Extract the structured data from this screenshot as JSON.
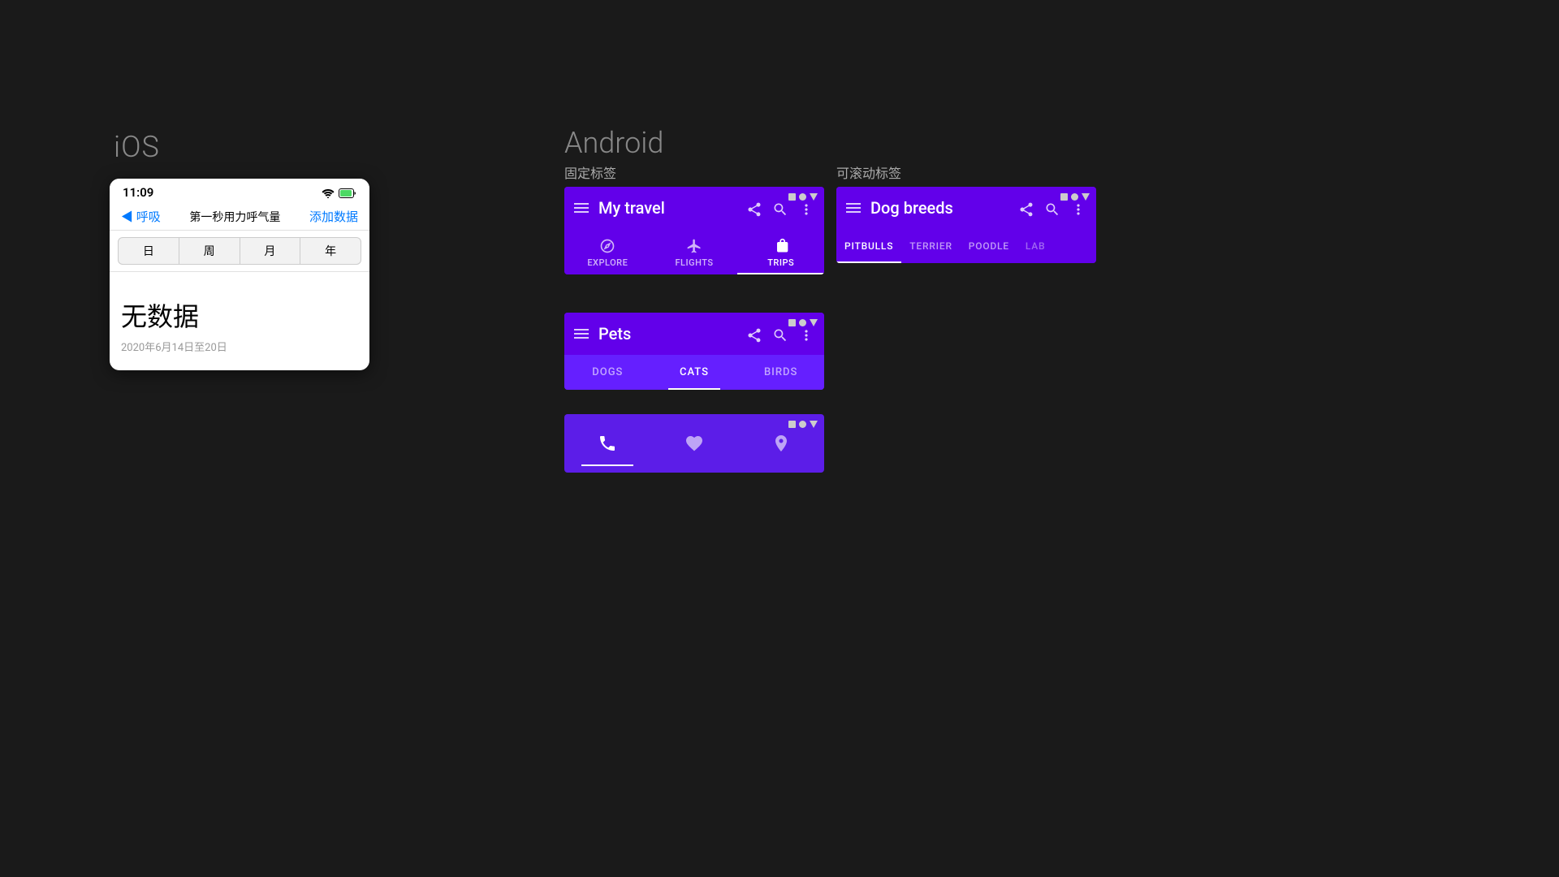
{
  "ios": {
    "section_label": "iOS",
    "status_bar": {
      "time": "11:09",
      "icons": "▶ 📶 🔋"
    },
    "nav": {
      "back_label": "◀ 呼吸",
      "title": "第一秒用力呼气量",
      "action": "添加数据"
    },
    "tabs": [
      "日",
      "周",
      "月",
      "年"
    ],
    "no_data": "无数据",
    "date_range": "2020年6月14日至20日"
  },
  "android": {
    "section_label": "Android",
    "fixed_label": "固定标签",
    "scrollable_label": "可滚动标签",
    "travel_card": {
      "title": "My travel",
      "tabs": [
        {
          "icon": "compass",
          "label": "EXPLORE",
          "active": false
        },
        {
          "icon": "flight",
          "label": "FLIGHTS",
          "active": false
        },
        {
          "icon": "briefcase",
          "label": "TRIPS",
          "active": true
        }
      ]
    },
    "pets_card": {
      "title": "Pets",
      "tabs": [
        {
          "label": "DOGS",
          "active": false
        },
        {
          "label": "CATS",
          "active": true
        },
        {
          "label": "BIRDS",
          "active": false
        }
      ]
    },
    "icons_card": {
      "tabs": [
        {
          "icon": "phone",
          "active": true
        },
        {
          "icon": "heart",
          "active": false
        },
        {
          "icon": "location",
          "active": false
        }
      ]
    },
    "dogbreeds_card": {
      "title": "Dog breeds",
      "tabs": [
        {
          "label": "PITBULLS",
          "active": true
        },
        {
          "label": "TERRIER",
          "active": false
        },
        {
          "label": "POODLE",
          "active": false
        },
        {
          "label": "LAB",
          "active": false,
          "partial": true
        }
      ]
    }
  }
}
